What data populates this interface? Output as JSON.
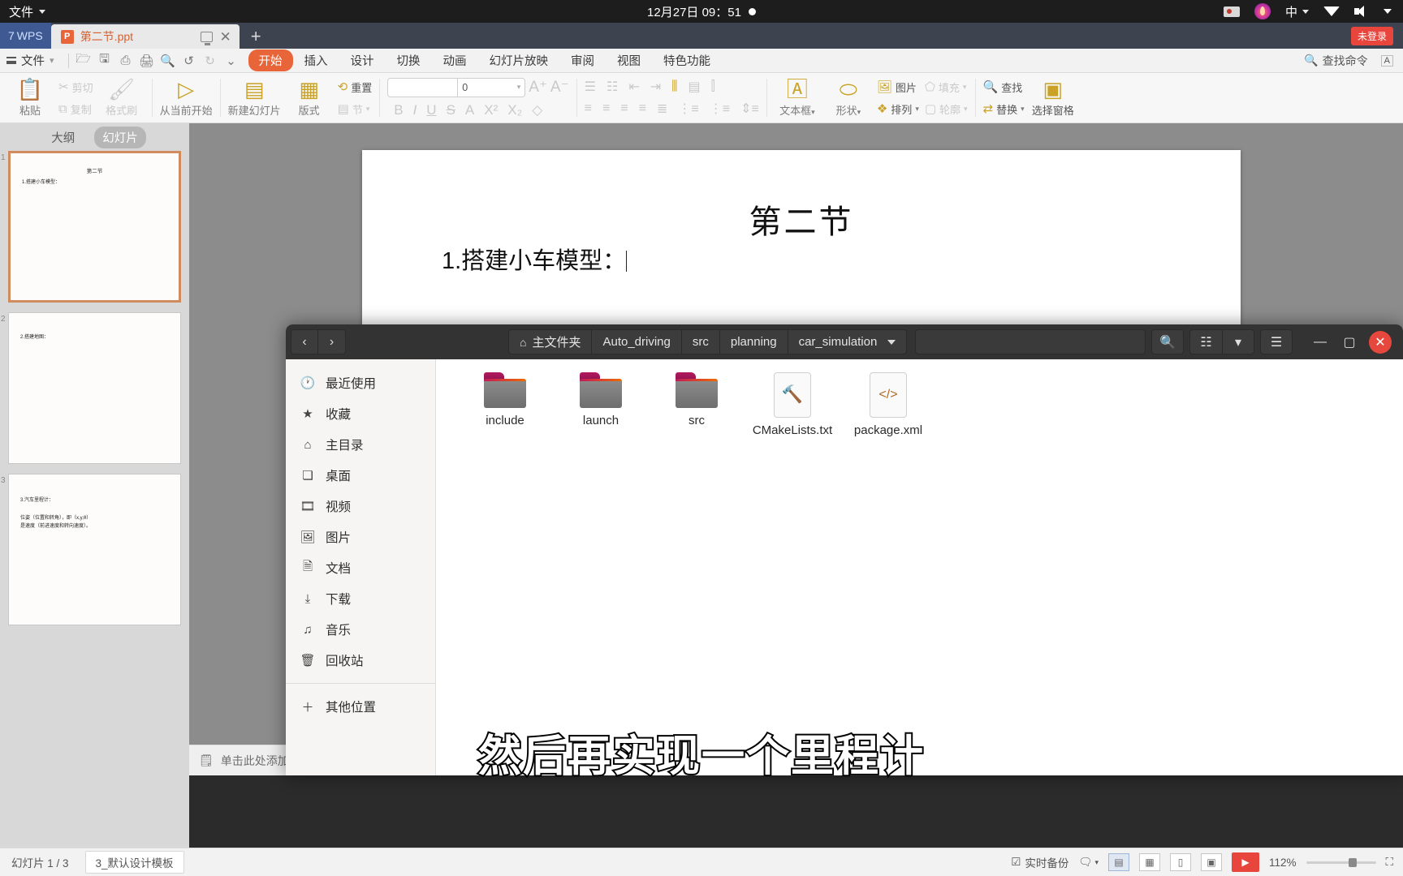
{
  "os_panel": {
    "files_menu": "文件",
    "clock": "12月27日  09：51",
    "tray": {
      "camera_icon": "screen-record-icon",
      "flame_icon": "flame-icon",
      "ime_label": "中",
      "wifi_icon": "wifi-icon",
      "volume_icon": "volume-icon",
      "power_icon": "power-caret-icon"
    }
  },
  "tabstrip": {
    "wps_badge": "WPS",
    "wps_badge_prefix": "7",
    "doc_tab": {
      "title": "第二节.ppt",
      "file_icon": "ppt-file-icon",
      "restore_icon": "restore-window-icon",
      "close_icon": "close-tab-icon"
    },
    "new_tab": "+",
    "login_badge": "未登录"
  },
  "menubar": {
    "file_label": "文件",
    "quick_access": [
      "open-icon",
      "save-icon",
      "save-as-icon",
      "print-icon",
      "print-preview-icon",
      "undo-icon",
      "redo-icon",
      "customize-icon"
    ],
    "items": [
      {
        "label": "开始",
        "active": true
      },
      {
        "label": "插入",
        "active": false
      },
      {
        "label": "设计",
        "active": false
      },
      {
        "label": "切换",
        "active": false
      },
      {
        "label": "动画",
        "active": false
      },
      {
        "label": "幻灯片放映",
        "active": false
      },
      {
        "label": "审阅",
        "active": false
      },
      {
        "label": "视图",
        "active": false
      },
      {
        "label": "特色功能",
        "active": false
      }
    ],
    "search_label": "查找命令",
    "collapse_icon": "collapse-ribbon-icon"
  },
  "ribbon": {
    "paste_label": "粘贴",
    "cut_label": "剪切",
    "copy_label": "复制",
    "format_painter_label": "格式刷",
    "start_from_current_label": "从当前开始",
    "new_slide_label": "新建幻灯片",
    "layout_label": "版式",
    "section_label": "节",
    "reset_label": "重置",
    "font_name": "",
    "font_size": "0",
    "grow_font_icon": "increase-font-icon",
    "shrink_font_icon": "decrease-font-icon",
    "bold_icon": "bold-icon",
    "italic_icon": "italic-icon",
    "underline_icon": "underline-icon",
    "strikethrough_icon": "strikethrough-icon",
    "font_color_icon": "font-color-icon",
    "superscript_icon": "superscript-icon",
    "subscript_icon": "subscript-icon",
    "clear_format_icon": "clear-format-icon",
    "textbox_label": "文本框",
    "shape_label": "形状",
    "picture_label": "图片",
    "arrange_label": "排列",
    "fill_label": "填充",
    "outline_label": "轮廓",
    "find_label": "查找",
    "replace_label": "替换",
    "select_pane_label": "选择窗格"
  },
  "left_pane": {
    "tabs": [
      {
        "label": "大纲",
        "active": false
      },
      {
        "label": "幻灯片",
        "active": true
      }
    ],
    "thumbnails": [
      {
        "number": "1",
        "selected": true,
        "title": "第二节",
        "lines": [
          "1.搭建小车模型："
        ]
      },
      {
        "number": "2",
        "selected": false,
        "title": "",
        "lines": [
          "2.搭建地图："
        ]
      },
      {
        "number": "3",
        "selected": false,
        "title": "",
        "lines": [
          "3.汽车里程计：",
          "位姿（位置和转角），即（x,y,θ）",
          "是速度（前进速度和转向速度）。"
        ]
      }
    ]
  },
  "slide": {
    "title": "第二节",
    "body": "1.搭建小车模型："
  },
  "subtitle_overlay": "然后再实现一个里程计",
  "file_manager": {
    "nav": {
      "back_icon": "back-arrow-icon",
      "forward_icon": "forward-arrow-icon"
    },
    "breadcrumbs": [
      {
        "label": "主文件夹",
        "icon": "home-icon",
        "has_caret": false
      },
      {
        "label": "Auto_driving",
        "icon": "",
        "has_caret": false
      },
      {
        "label": "src",
        "icon": "",
        "has_caret": false
      },
      {
        "label": "planning",
        "icon": "",
        "has_caret": false
      },
      {
        "label": "car_simulation",
        "icon": "",
        "has_caret": true
      }
    ],
    "toolbar": {
      "search_icon": "search-icon",
      "view_list_icon": "list-view-icon",
      "view_caret_icon": "chevron-down-icon",
      "menu_icon": "hamburger-menu-icon",
      "minimize_icon": "minimize-window-icon",
      "maximize_icon": "maximize-window-icon",
      "close_icon": "close-window-icon"
    },
    "sidebar": [
      {
        "label": "最近使用",
        "icon": "recent-clock-icon"
      },
      {
        "label": "收藏",
        "icon": "star-icon"
      },
      {
        "label": "主目录",
        "icon": "home-icon"
      },
      {
        "label": "桌面",
        "icon": "desktop-icon"
      },
      {
        "label": "视频",
        "icon": "video-icon"
      },
      {
        "label": "图片",
        "icon": "picture-icon"
      },
      {
        "label": "文档",
        "icon": "document-icon"
      },
      {
        "label": "下载",
        "icon": "download-icon"
      },
      {
        "label": "音乐",
        "icon": "music-icon"
      },
      {
        "label": "回收站",
        "icon": "trash-icon"
      },
      {
        "label": "其他位置",
        "icon": "plus-icon"
      }
    ],
    "files": [
      {
        "name": "include",
        "type": "folder"
      },
      {
        "name": "launch",
        "type": "folder"
      },
      {
        "name": "src",
        "type": "folder"
      },
      {
        "name": "CMakeLists.txt",
        "type": "cmake"
      },
      {
        "name": "package.xml",
        "type": "xml"
      }
    ]
  },
  "notes": {
    "placeholder": "单击此处添加备注",
    "icon": "notes-icon"
  },
  "status_bar": {
    "slide_count": "幻灯片 1 / 3",
    "template": "3_默认设计模板",
    "backup": "实时备份",
    "backup_icon": "backup-icon",
    "comment_icon": "comment-icon",
    "views": [
      "normal-view-icon",
      "sorter-view-icon",
      "reading-view-icon",
      "notes-view-icon"
    ],
    "play_icon": "slideshow-play-icon",
    "zoom": "112%",
    "fit_icon": "fit-to-window-icon"
  }
}
